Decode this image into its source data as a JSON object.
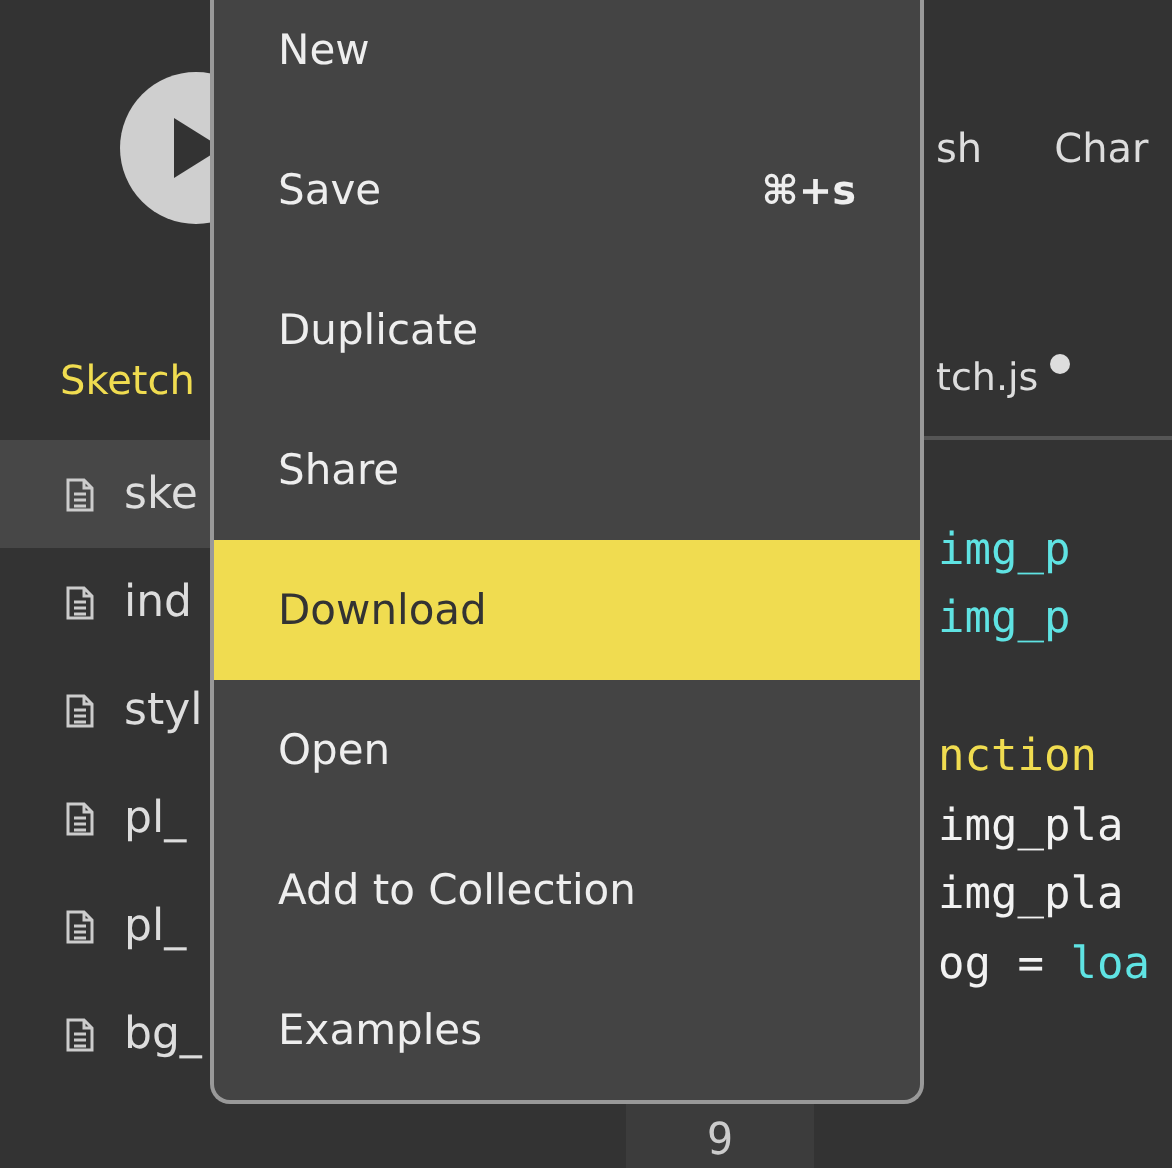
{
  "toolbar": {
    "items": [
      "sh",
      "Char"
    ]
  },
  "sidebar": {
    "title": "Sketch",
    "files": [
      {
        "name": "ske",
        "selected": true
      },
      {
        "name": "ind",
        "selected": false
      },
      {
        "name": "styl",
        "selected": false
      },
      {
        "name": "pl_",
        "selected": false
      },
      {
        "name": "pl_",
        "selected": false
      },
      {
        "name": "bg_",
        "selected": false
      }
    ]
  },
  "editor": {
    "tab": {
      "name": "tch.js",
      "unsaved": true
    },
    "line_numbers": [
      "9"
    ],
    "code_blocks": [
      [
        [
          {
            "kind": "variable",
            "text": "img_p"
          }
        ],
        [
          {
            "kind": "variable",
            "text": "img_p"
          }
        ]
      ],
      [
        [
          {
            "kind": "keyword",
            "text": "nction"
          }
        ],
        [
          {
            "kind": "plain",
            "text": "img_pla"
          }
        ],
        [
          {
            "kind": "plain",
            "text": "img_pla"
          }
        ],
        [
          {
            "kind": "plain",
            "text": "og = "
          },
          {
            "kind": "variable",
            "text": "loa"
          }
        ]
      ]
    ]
  },
  "file_menu": {
    "items": [
      {
        "label": "New",
        "selected": false
      },
      {
        "label": "Save",
        "shortcut": "⌘+s",
        "selected": false
      },
      {
        "label": "Duplicate",
        "selected": false
      },
      {
        "label": "Share",
        "selected": false
      },
      {
        "label": "Download",
        "selected": true
      },
      {
        "label": "Open",
        "selected": false
      },
      {
        "label": "Add to Collection",
        "selected": false
      },
      {
        "label": "Examples",
        "selected": false
      }
    ]
  }
}
